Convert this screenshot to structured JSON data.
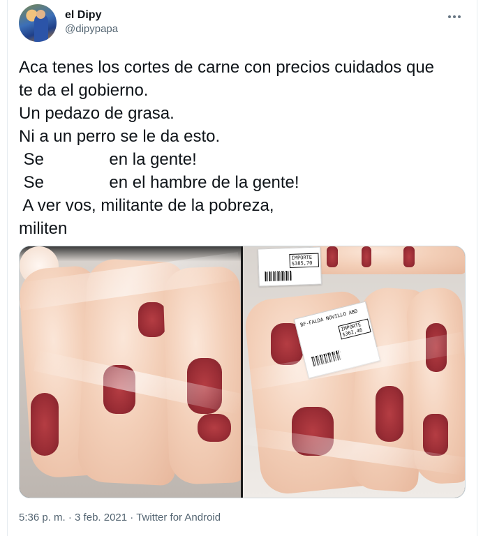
{
  "user": {
    "display_name": "el Dipy",
    "handle": "@dipypapa"
  },
  "tweet": {
    "lines": [
      "Aca tenes los cortes de carne con precios cuidados que",
      "te da el gobierno.",
      "Un pedazo de grasa.",
      "Ni a un perro se le da esto.",
      " Se              en la gente!",
      " Se              en el hambre de la gente!",
      " A ver vos, militante de la pobreza,",
      "militen"
    ]
  },
  "media": {
    "right_label_main": {
      "title": "BF-FALDA NOVILLO ABD",
      "importe_label": "IMPORTE",
      "importe_value": "$362,46"
    },
    "right_label_top": {
      "importe_label": "IMPORTE",
      "importe_value": "$385,70"
    }
  },
  "meta": {
    "time": "5:36 p. m.",
    "separator": "·",
    "date": "3 feb. 2021",
    "source": "Twitter for Android"
  },
  "icons": {
    "more": "more-horizontal-icon"
  }
}
